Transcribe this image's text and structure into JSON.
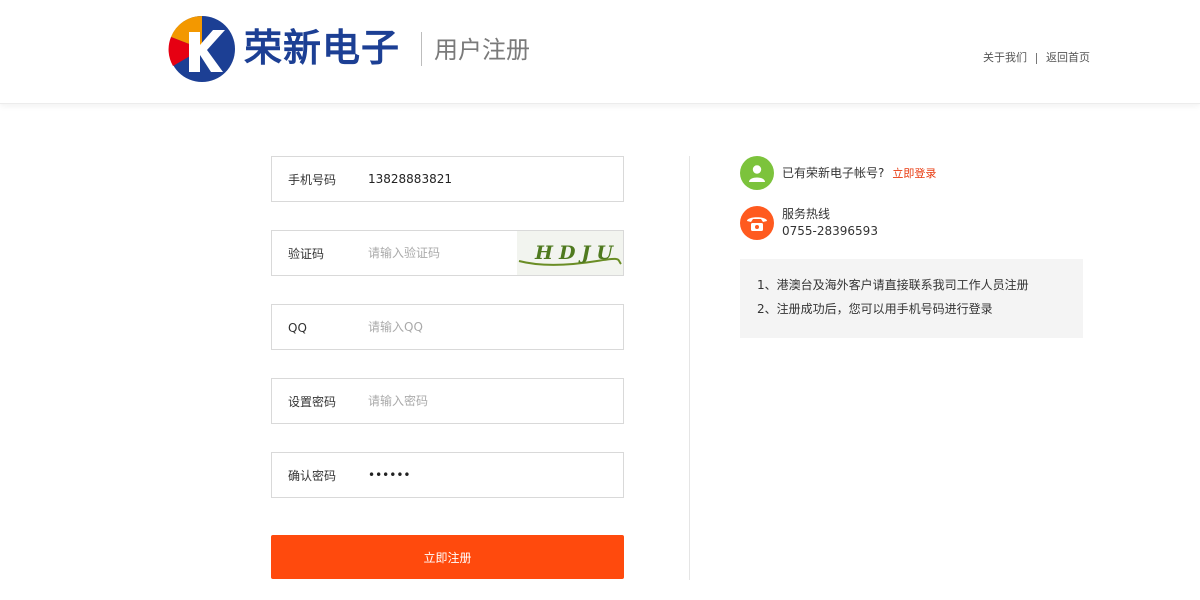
{
  "header": {
    "brand": "荣新电子",
    "page_title": "用户注册",
    "links": [
      "关于我们",
      "返回首页"
    ]
  },
  "form": {
    "phone": {
      "label": "手机号码",
      "value": "13828883821"
    },
    "captcha": {
      "label": "验证码",
      "placeholder": "请输入验证码",
      "code": "HDJU"
    },
    "qq": {
      "label": "QQ",
      "placeholder": "请输入QQ"
    },
    "password": {
      "label": "设置密码",
      "placeholder": "请输入密码"
    },
    "confirm": {
      "label": "确认密码",
      "value": "******"
    },
    "submit_label": "立即注册"
  },
  "sidebar": {
    "account_prompt": "已有荣新电子帐号?",
    "login_link": "立即登录",
    "hotline_label": "服务热线",
    "hotline_number": "0755-28396593",
    "notices": [
      "1、港澳台及海外客户请直接联系我司工作人员注册",
      "2、注册成功后，您可以用手机号码进行登录"
    ]
  },
  "colors": {
    "brand_blue": "#1c3f94",
    "accent_orange": "#ff4a0d",
    "link_red": "#e8380d",
    "user_icon_green": "#7cc33c",
    "phone_icon_orange": "#ff5a1f"
  }
}
